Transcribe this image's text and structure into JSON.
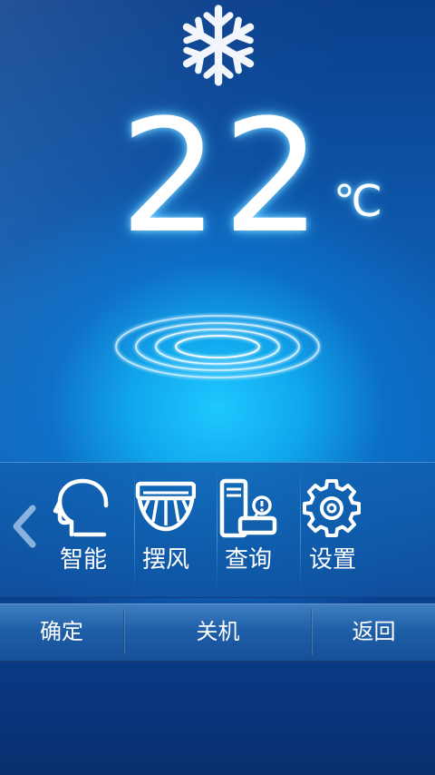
{
  "status": {
    "mode_icon": "snowflake-icon",
    "temperature": "22",
    "unit": "℃"
  },
  "indicator": {
    "icon": "airflow-ripple-icon"
  },
  "functions": {
    "prev_icon": "chevron-left-icon",
    "items": [
      {
        "label": "智能",
        "icon": "head-profile-icon"
      },
      {
        "label": "摆风",
        "icon": "swing-vane-icon"
      },
      {
        "label": "查询",
        "icon": "unit-info-icon"
      },
      {
        "label": "设置",
        "icon": "gear-icon"
      }
    ]
  },
  "bottom": {
    "confirm": "确定",
    "power_off": "关机",
    "back": "返回"
  },
  "colors": {
    "background_top": "#0a3f8c",
    "background_glow": "#1ec8ff",
    "text": "#ffffff",
    "glow": "#80dcff"
  }
}
